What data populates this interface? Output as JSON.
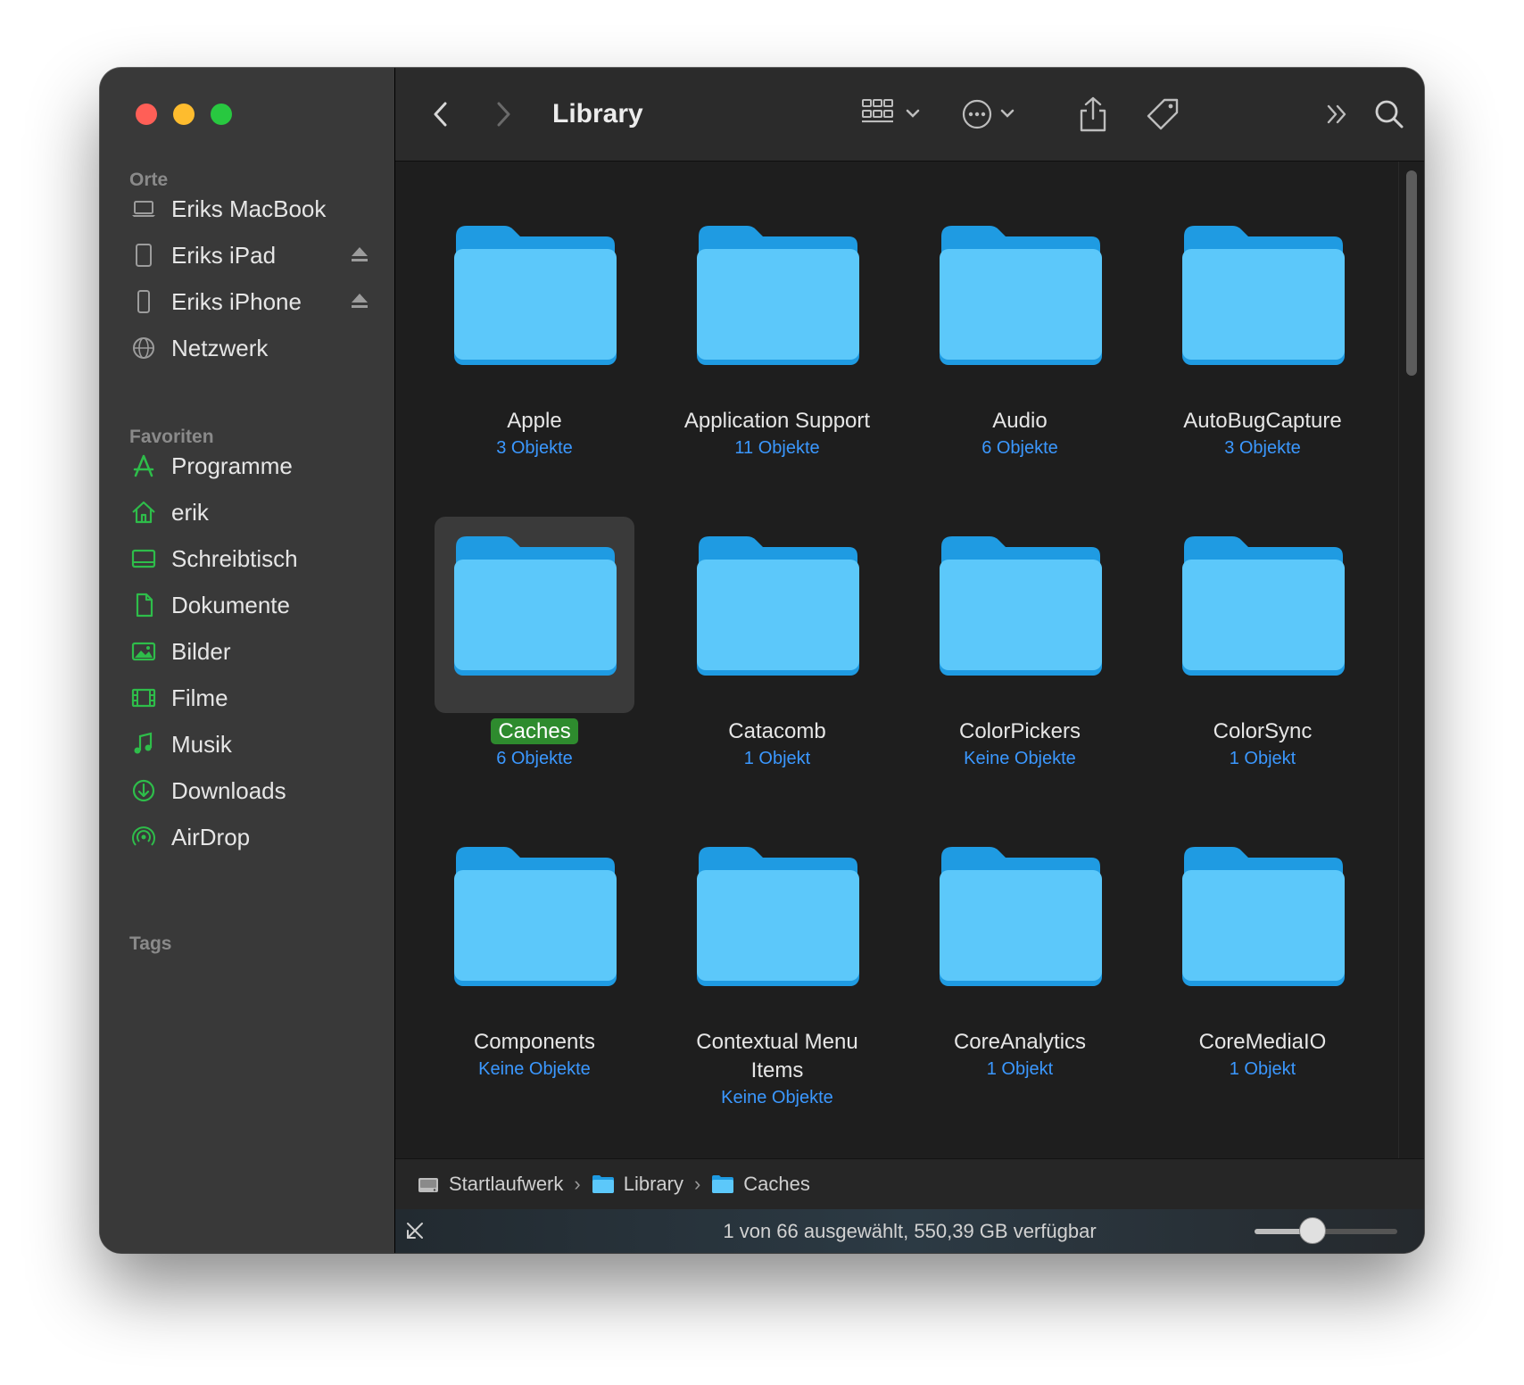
{
  "sidebar": {
    "sections": [
      {
        "title": "Orte",
        "items": [
          {
            "label": "Eriks MacBook",
            "icon": "laptop-icon"
          },
          {
            "label": "Eriks iPad",
            "icon": "ipad-icon",
            "eject": true
          },
          {
            "label": "Eriks iPhone",
            "icon": "iphone-icon",
            "eject": true
          },
          {
            "label": "Netzwerk",
            "icon": "network-globe-icon"
          }
        ]
      },
      {
        "title": "Favoriten",
        "items": [
          {
            "label": "Programme",
            "icon": "applications-icon"
          },
          {
            "label": "erik",
            "icon": "home-icon"
          },
          {
            "label": "Schreibtisch",
            "icon": "desktop-icon"
          },
          {
            "label": "Dokumente",
            "icon": "document-icon"
          },
          {
            "label": "Bilder",
            "icon": "pictures-icon"
          },
          {
            "label": "Filme",
            "icon": "movies-icon"
          },
          {
            "label": "Musik",
            "icon": "music-icon"
          },
          {
            "label": "Downloads",
            "icon": "downloads-icon"
          },
          {
            "label": "AirDrop",
            "icon": "airdrop-icon"
          }
        ]
      },
      {
        "title": "Tags",
        "items": []
      }
    ],
    "accent_color": "#2ebd4a"
  },
  "toolbar": {
    "title": "Library"
  },
  "folders": [
    {
      "name": "Apple",
      "count": "3 Objekte"
    },
    {
      "name": "Application Support",
      "count": "11 Objekte"
    },
    {
      "name": "Audio",
      "count": "6 Objekte"
    },
    {
      "name": "AutoBugCapture",
      "count": "3 Objekte"
    },
    {
      "name": "Caches",
      "count": "6 Objekte",
      "selected": true
    },
    {
      "name": "Catacomb",
      "count": "1 Objekt"
    },
    {
      "name": "ColorPickers",
      "count": "Keine Objekte"
    },
    {
      "name": "ColorSync",
      "count": "1 Objekt"
    },
    {
      "name": "Components",
      "count": "Keine Objekte"
    },
    {
      "name": "Contextual Menu Items",
      "name_lines": [
        "Contextual Menu",
        "Items"
      ],
      "count": "Keine Objekte"
    },
    {
      "name": "CoreAnalytics",
      "count": "1 Objekt"
    },
    {
      "name": "CoreMediaIO",
      "count": "1 Objekt"
    }
  ],
  "pathbar": {
    "crumbs": [
      "Startlaufwerk",
      "Library",
      "Caches"
    ]
  },
  "status": {
    "text": "1 von 66 ausgewählt, 550,39 GB verfügbar",
    "icon_size_level": 0.4
  },
  "colors": {
    "folder": "#5cc8fa",
    "folder_dark": "#1f9be2",
    "count_text": "#3b98ff",
    "selection_label": "#2e8b2e"
  }
}
